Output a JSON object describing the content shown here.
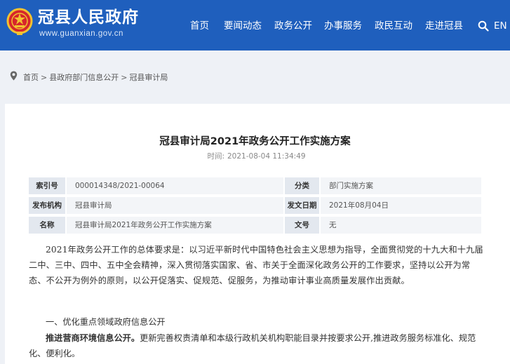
{
  "header": {
    "site_title": "冠县人民政府",
    "site_domain": "www.guanxian.gov.cn",
    "nav": [
      "首页",
      "要闻动态",
      "政务公开",
      "办事服务",
      "政民互动",
      "走进冠县"
    ],
    "lang_label": "EN",
    "search_icon": "search-icon",
    "emblem_icon": "national-emblem-icon"
  },
  "breadcrumb": {
    "items": [
      "首页",
      "县政府部门信息公开",
      "冠县审计局"
    ],
    "pin_icon": "location-pin-icon"
  },
  "article": {
    "title": "冠县审计局2021年政务公开工作实施方案",
    "time_label": "时间:",
    "time_value": "2021-08-04 11:34:49",
    "meta": [
      {
        "label": "索引号",
        "value": "000014348/2021-00064",
        "label2": "分类",
        "value2": "部门实施方案"
      },
      {
        "label": "发布机构",
        "value": "冠县审计局",
        "label2": "发文日期",
        "value2": "2021年08月04日"
      },
      {
        "label": "名称",
        "value": "冠县审计局2021年政务公开工作实施方案",
        "label2": "文号",
        "value2": "无"
      }
    ],
    "paragraph1": "2021年政务公开工作的总体要求是：以习近平新时代中国特色社会主义思想为指导，全面贯彻党的十九大和十九届二中、三中、四中、五中全会精神，深入贯彻落实国家、省、市关于全面深化政务公开的工作要求，坚持以公开为常态、不公开为例外的原则，以公开促落实、促规范、促服务，为推动审计事业高质量发展作出贡献。",
    "section1": "一、优化重点领域政府信息公开",
    "p3_bold": "推进营商环境信息公开。",
    "p3_text": "更新完善权责清单和本级行政机关机构职能目录并按要求公开,推进政务服务标准化、规范化、便利化。"
  }
}
